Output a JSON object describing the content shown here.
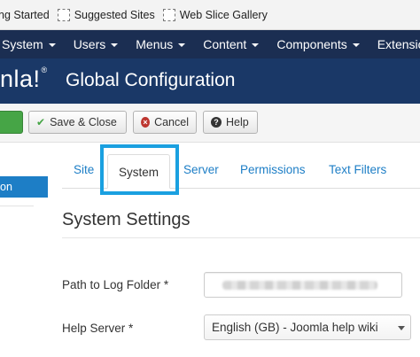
{
  "favorites": [
    {
      "label": "ng Started"
    },
    {
      "label": "Suggested Sites"
    },
    {
      "label": "Web Slice Gallery"
    }
  ],
  "topnav": {
    "items": [
      {
        "label": "System"
      },
      {
        "label": "Users"
      },
      {
        "label": "Menus"
      },
      {
        "label": "Content"
      },
      {
        "label": "Components"
      },
      {
        "label": "Extensions"
      }
    ]
  },
  "header": {
    "logo": "nla!",
    "logo_mark": "®",
    "title": "Global Configuration"
  },
  "toolbar": {
    "save_close": "Save & Close",
    "cancel": "Cancel",
    "help": "Help"
  },
  "sidebar": {
    "active_item": "on"
  },
  "tabs": [
    {
      "label": "Site"
    },
    {
      "label": "System"
    },
    {
      "label": "Server"
    },
    {
      "label": "Permissions"
    },
    {
      "label": "Text Filters"
    }
  ],
  "section": {
    "title": "System Settings"
  },
  "fields": {
    "log_folder_label": "Path to Log Folder *",
    "help_server_label": "Help Server *",
    "help_server_value": "English (GB) - Joomla help wiki"
  }
}
